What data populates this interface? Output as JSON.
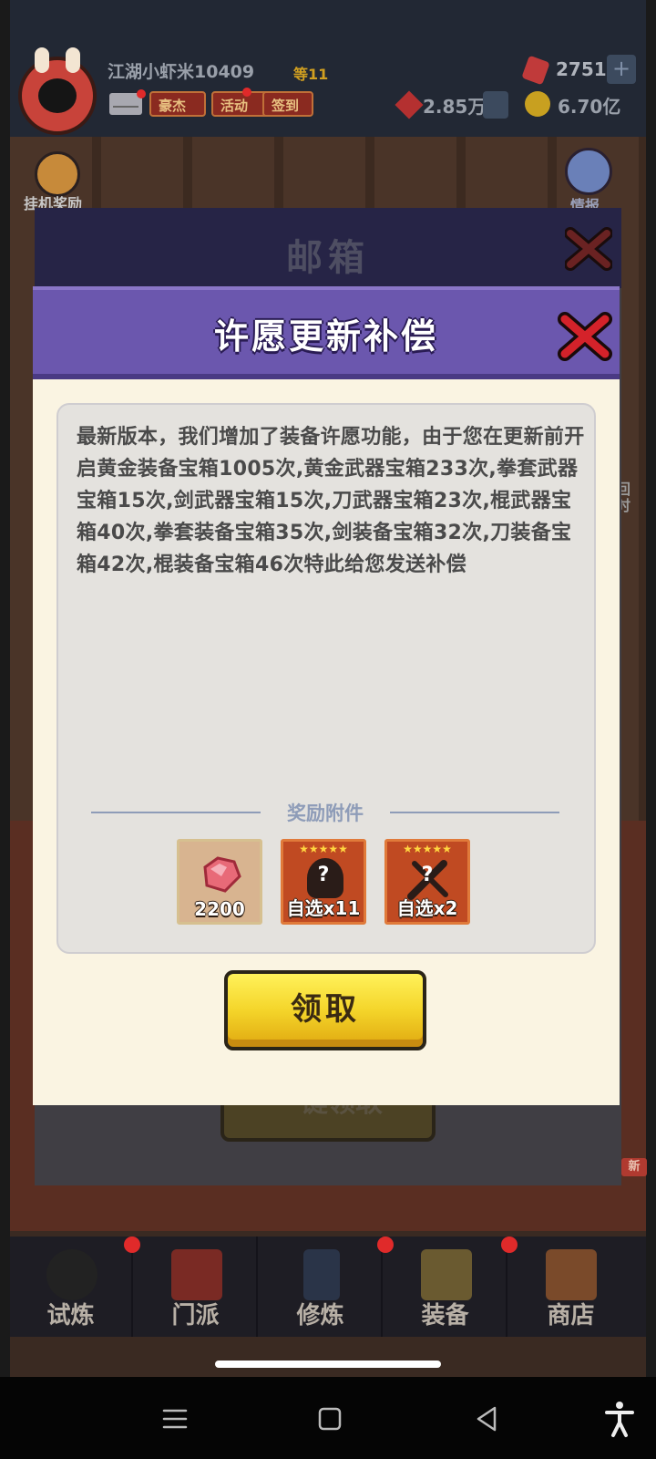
{
  "hud": {
    "player_name": "江湖小虾米10409",
    "player_level": "等11",
    "buttons": [
      "豪杰",
      "活动",
      "签到"
    ],
    "gems": "2751",
    "plus_label": "+",
    "power": "2.85万",
    "coins": "6.70亿"
  },
  "side": {
    "afk_reward_label": "挂机奖励",
    "ghost_label": "情报",
    "right_label": "回时"
  },
  "mailbox": {
    "title": "邮箱",
    "claim_all_label": "一键领取"
  },
  "dialog": {
    "title": "许愿更新补偿",
    "message": "最新版本，我们增加了装备许愿功能，由于您在更新前开启黄金装备宝箱1005次,黄金武器宝箱233次,拳套武器宝箱15次,剑武器宝箱15次,刀武器宝箱23次,棍武器宝箱40次,拳套装备宝箱35次,剑装备宝箱32次,刀装备宝箱42次,棍装备宝箱46次特此给您发送补偿",
    "attachments_label": "奖励附件",
    "rewards": [
      {
        "icon": "gem-icon",
        "count": "2200"
      },
      {
        "icon": "armor-select-icon",
        "stars": "★★★★★",
        "mark": "?",
        "count": "自选x11"
      },
      {
        "icon": "weapon-select-icon",
        "stars": "★★★★★",
        "mark": "?",
        "count": "自选x2"
      }
    ],
    "claim_label": "领取"
  },
  "tabbar": {
    "tabs": [
      "试炼",
      "门派",
      "修炼",
      "装备",
      "商店"
    ],
    "new_badge": "新"
  },
  "colors": {
    "dialog_header": "#6b57ae",
    "claim_button": "#f4d52a",
    "dialog_body": "#faf4e2"
  }
}
